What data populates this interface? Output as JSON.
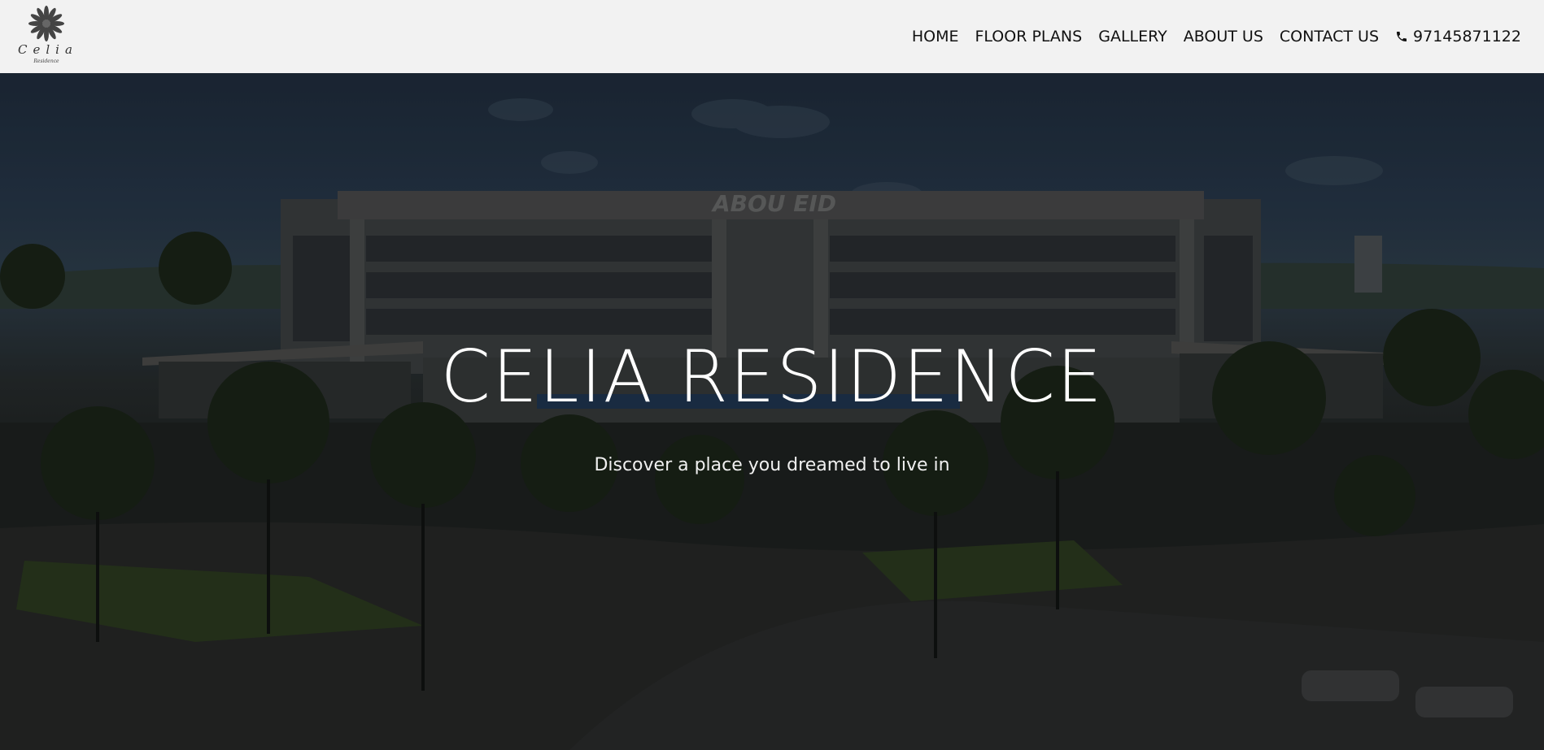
{
  "header": {
    "logo": {
      "name": "Celia",
      "tagline": "Residence"
    },
    "nav": [
      {
        "label": "HOME"
      },
      {
        "label": "FLOOR PLANS"
      },
      {
        "label": "GALLERY"
      },
      {
        "label": "ABOUT US"
      },
      {
        "label": "CONTACT US"
      }
    ],
    "phone": {
      "icon": "phone-icon",
      "number": "97145871122"
    }
  },
  "hero": {
    "title": "CELIA RESIDENCE",
    "subtitle": "Discover a place you dreamed to live in",
    "background_image": "building-rendering",
    "building_sign": "ABOU EID"
  },
  "colors": {
    "header_bg": "#f2f2f2",
    "nav_text": "#111111",
    "hero_text": "#ffffff"
  }
}
